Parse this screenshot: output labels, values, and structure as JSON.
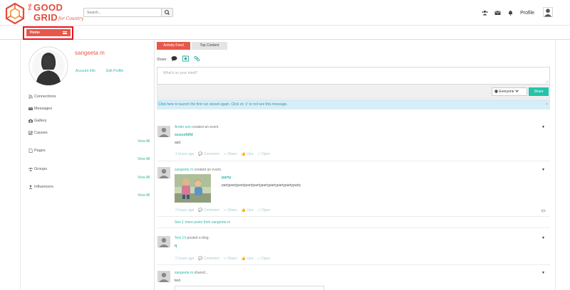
{
  "brand": {
    "line1": "THE",
    "line2": "GOOD",
    "line3": "GRID",
    "tagline": "for Country"
  },
  "search": {
    "placeholder": "Search..."
  },
  "header": {
    "profile_label": "Profile"
  },
  "homebar": {
    "home_label": "Home"
  },
  "profile": {
    "name": "sangeeta m",
    "account_info": "Account Info",
    "edit_profile": "Edit Profile"
  },
  "nav": {
    "connections": "Connections",
    "messages": "Messages",
    "gallery": "Gallery",
    "causes": "Causes",
    "pages": "Pages",
    "groups": "Groups",
    "influencers": "Influencers",
    "view_all": "View All"
  },
  "tabs": {
    "activity_feed": "Activity Feed",
    "top_content": "Top Content"
  },
  "composer": {
    "share_label": "Share:",
    "placeholder": "What's on your mind?",
    "privacy": "Everyone",
    "share_button": "Share"
  },
  "alert": {
    "link": "Click here",
    "text": " to launch the first run wizard again. Click on 'x' to not see this message.",
    "close": "×"
  },
  "posts": [
    {
      "author": "Ander son",
      "action": " created an event.",
      "title": "sssssfdfd",
      "body": "asd",
      "time": "1 hours ago",
      "comment": "Comment",
      "share": "Share",
      "like": "Like",
      "open": "Open"
    },
    {
      "author": "sangeeta m",
      "action": " created an event.",
      "title": "party",
      "body": "partypartypartypartypartypartypartypartypartyparty",
      "time": "2 hours ago",
      "comment": "Comment",
      "share": "Share",
      "like": "Like",
      "open": "Open",
      "more": "See 1 more posts from sangeeta m"
    },
    {
      "author": "Test 13",
      "action": " posted a blog.",
      "title": "q",
      "time": "2 hours ago",
      "comment": "Comment",
      "share": "Share",
      "like": "Like",
      "open": "Open"
    },
    {
      "author": "sangeeta m",
      "action": " shared...",
      "body": "test"
    }
  ],
  "colors": {
    "accent": "#e8574a",
    "teal": "#2fb7a9",
    "share_green": "#25c3a8",
    "highlight_red": "#e8121f"
  }
}
